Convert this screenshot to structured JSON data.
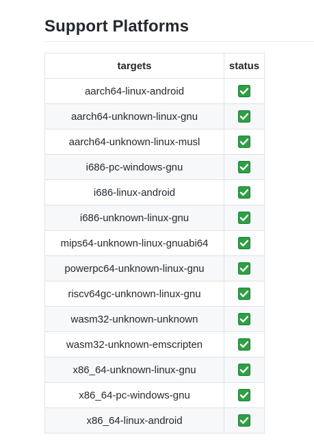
{
  "page": {
    "heading": "Support Platforms"
  },
  "table": {
    "headers": {
      "targets": "targets",
      "status": "status"
    },
    "rows": [
      {
        "target": "aarch64-linux-android",
        "status": "supported"
      },
      {
        "target": "aarch64-unknown-linux-gnu",
        "status": "supported"
      },
      {
        "target": "aarch64-unknown-linux-musl",
        "status": "supported"
      },
      {
        "target": "i686-pc-windows-gnu",
        "status": "supported"
      },
      {
        "target": "i686-linux-android",
        "status": "supported"
      },
      {
        "target": "i686-unknown-linux-gnu",
        "status": "supported"
      },
      {
        "target": "mips64-unknown-linux-gnuabi64",
        "status": "supported"
      },
      {
        "target": "powerpc64-unknown-linux-gnu",
        "status": "supported"
      },
      {
        "target": "riscv64gc-unknown-linux-gnu",
        "status": "supported"
      },
      {
        "target": "wasm32-unknown-unknown",
        "status": "supported"
      },
      {
        "target": "wasm32-unknown-emscripten",
        "status": "supported"
      },
      {
        "target": "x86_64-unknown-linux-gnu",
        "status": "supported"
      },
      {
        "target": "x86_64-pc-windows-gnu",
        "status": "supported"
      },
      {
        "target": "x86_64-linux-android",
        "status": "supported"
      }
    ]
  },
  "icons": {
    "status_supported": "check-mark-button-icon"
  },
  "colors": {
    "check_fill": "#2ea043",
    "check_border": "#1a7f37",
    "check_mark": "#ffffff",
    "row_alt": "#f6f8fa",
    "border": "#dfe2e5"
  }
}
